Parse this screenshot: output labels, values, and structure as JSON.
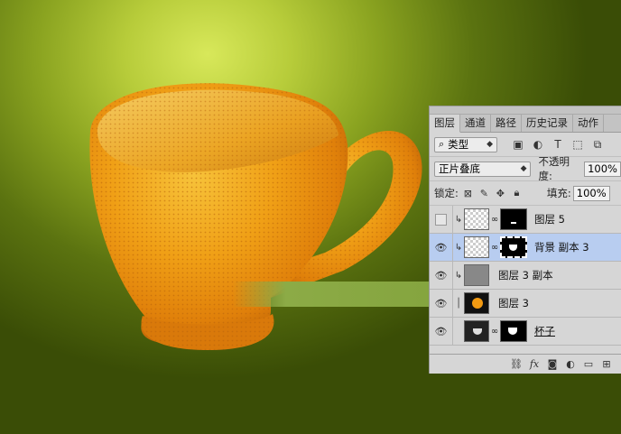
{
  "colors": {
    "bg_light": "#d8e85a",
    "bg_dark": "#3a4d06",
    "orange": "#f29a12",
    "selected_row": "#b8cdf0"
  },
  "panel": {
    "tabs": [
      {
        "label": "图层"
      },
      {
        "label": "通道"
      },
      {
        "label": "路径"
      },
      {
        "label": "历史记录"
      },
      {
        "label": "动作"
      }
    ],
    "filter": {
      "icon": "search-icon",
      "label": "类型"
    },
    "blend_mode": "正片叠底",
    "opacity_label": "不透明度:",
    "opacity_value": "100%",
    "lock_label": "锁定:",
    "fill_label": "填充:",
    "fill_value": "100%",
    "layers": [
      {
        "name": "图层 5",
        "visible": false,
        "clipped": true,
        "has_mask": true,
        "selected": false
      },
      {
        "name": "背景 副本 3",
        "visible": true,
        "clipped": true,
        "has_mask": true,
        "selected": true
      },
      {
        "name": "图层 3 副本",
        "visible": true,
        "clipped": true,
        "has_mask": false,
        "selected": false
      },
      {
        "name": "图层 3",
        "visible": true,
        "clipped": false,
        "has_mask": false,
        "selected": false
      },
      {
        "name": "杯子",
        "visible": true,
        "clipped": false,
        "has_mask": true,
        "selected": false
      }
    ]
  }
}
